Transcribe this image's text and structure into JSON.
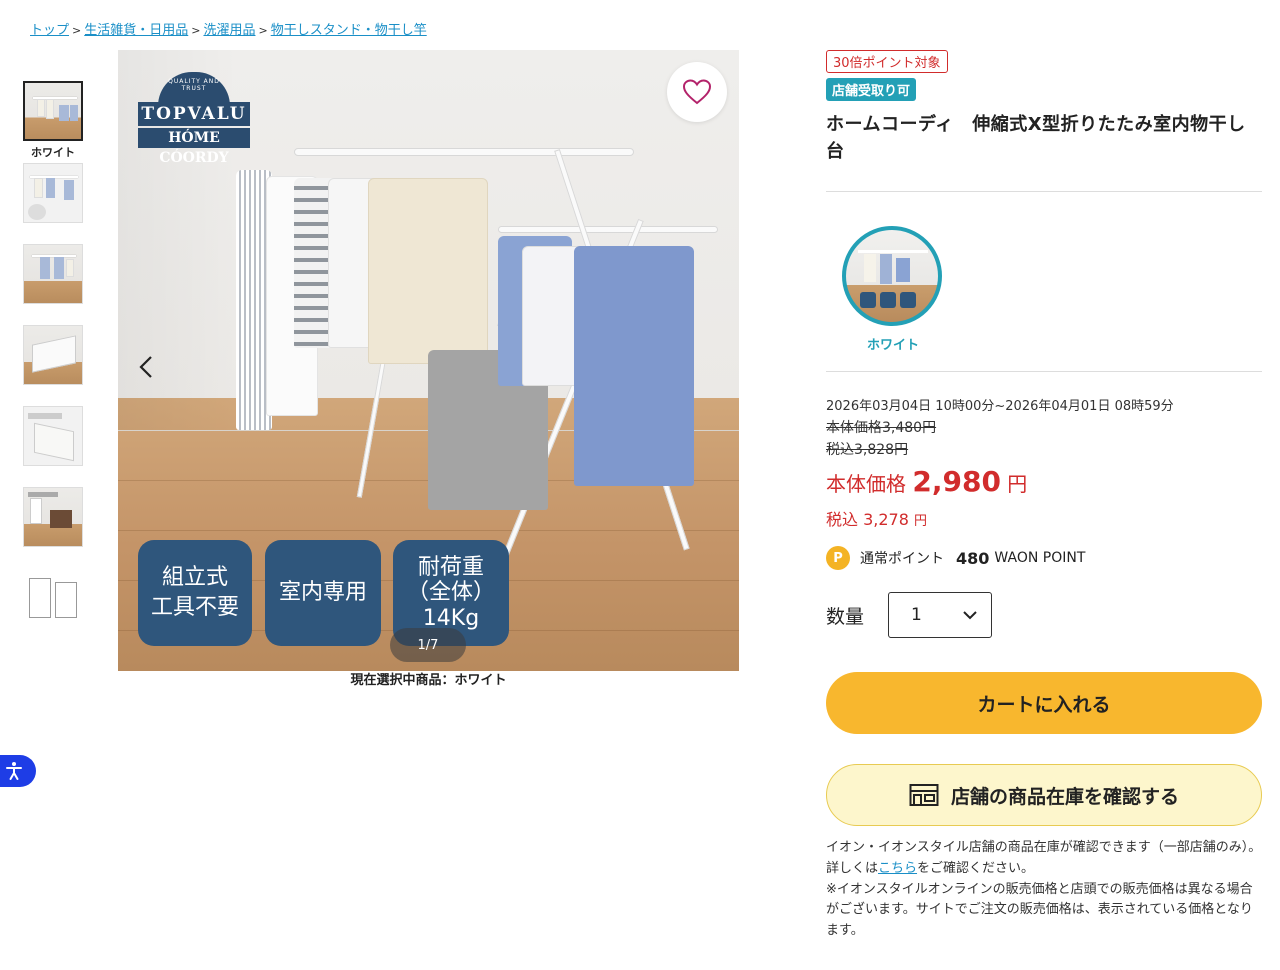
{
  "breadcrumb": {
    "items": [
      "トップ",
      "生活雑貨・日用品",
      "洗濯用品",
      "物干しスタンド・物干し竿"
    ],
    "separator": ">"
  },
  "gallery": {
    "selected_thumb_caption": "ホワイト",
    "logo_arc_text": "QUALITY AND TRUST",
    "logo_brand": "TOPVALU",
    "logo_sub": "HÓME CÓORDY",
    "badges": [
      "組立式\n工具不要",
      "室内専用",
      "耐荷重\n（全体）\n14Kg"
    ],
    "counter": "1/7",
    "caption": "現在選択中商品：ホワイト"
  },
  "product": {
    "tag_points": "30倍ポイント対象",
    "tag_store": "店舗受取り可",
    "title": "ホームコーディ　伸縮式X型折りたたみ室内物干し台",
    "variant_label": "ホワイト",
    "period": "2026年03月04日 10時00分~2026年04月01日 08時59分",
    "orig_price": "本体価格3,480円",
    "orig_price_tax": "税込3,828円",
    "price_label": "本体価格",
    "price_value": "2,980",
    "price_unit": "円",
    "tax_label": "税込",
    "tax_value": "3,278",
    "tax_unit": "円",
    "points_icon": "P",
    "points_label": "通常ポイント",
    "points_value": "480",
    "points_unit": "WAON POINT",
    "qty_label": "数量",
    "qty_value": "1",
    "cart_button": "カートに入れる",
    "store_button": "店舗の商品在庫を確認する",
    "note_part1": "イオン・イオンスタイル店舗の商品在庫が確認できます（一部店舗のみ）。詳しくは",
    "note_link": "こちら",
    "note_part2": "をご確認ください。",
    "note_2": "※イオンスタイルオンラインの販売価格と店頭での販売価格は異なる場合がございます。サイトでご注文の販売価格は、表示されている価格となります。"
  },
  "colors": {
    "accent_red": "#d12c2c",
    "teal": "#23a0b6",
    "cart_yellow": "#f8b72e",
    "badge_navy": "#2f567c",
    "link_blue": "#1a8fc7"
  },
  "icons": [
    "heart-icon",
    "chevron-left-icon",
    "chevron-right-icon",
    "chevron-down-icon",
    "store-icon",
    "accessibility-icon",
    "point-icon"
  ]
}
